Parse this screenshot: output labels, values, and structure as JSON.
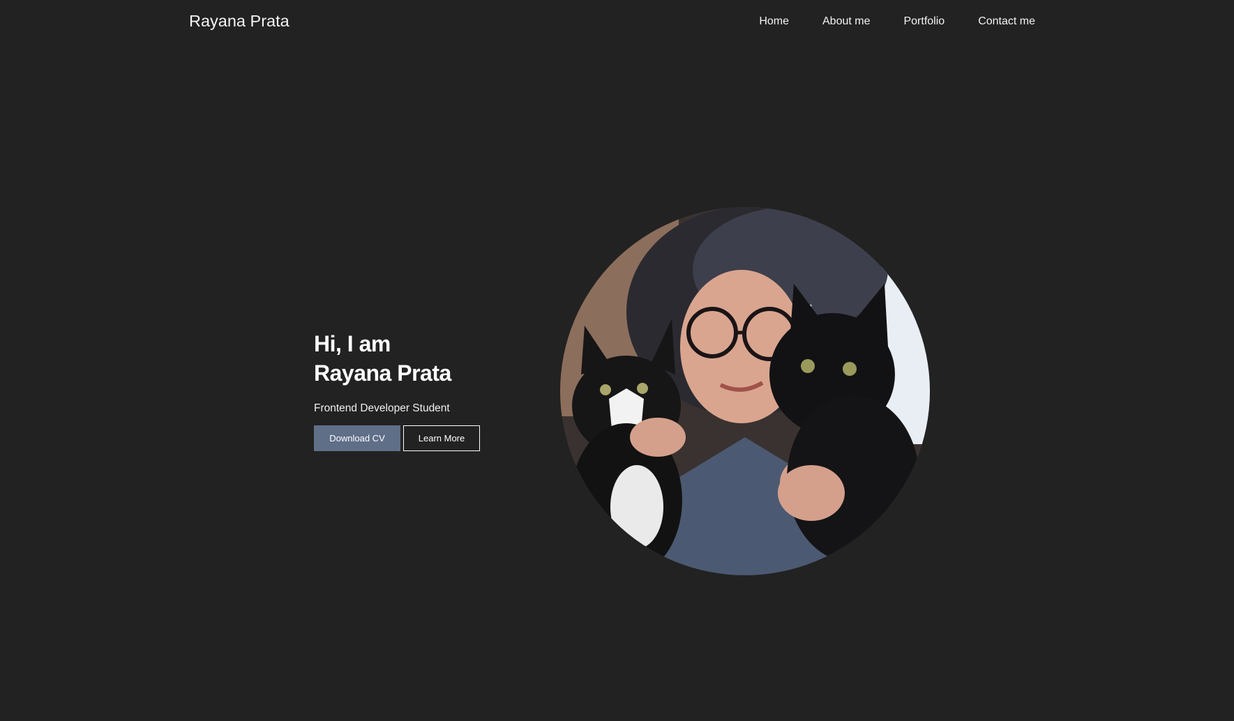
{
  "header": {
    "brand": "Rayana Prata",
    "nav": [
      {
        "label": "Home"
      },
      {
        "label": "About me"
      },
      {
        "label": "Portfolio"
      },
      {
        "label": "Contact me"
      }
    ]
  },
  "hero": {
    "greeting": "Hi, I am",
    "name": "Rayana Prata",
    "subtitle": "Frontend Developer Student",
    "buttons": {
      "primary_label": "Download CV",
      "secondary_label": "Learn More"
    },
    "photo_icon": "profile-photo"
  },
  "colors": {
    "background": "#222222",
    "text": "#ffffff",
    "primary_button": "#5f6f88"
  }
}
